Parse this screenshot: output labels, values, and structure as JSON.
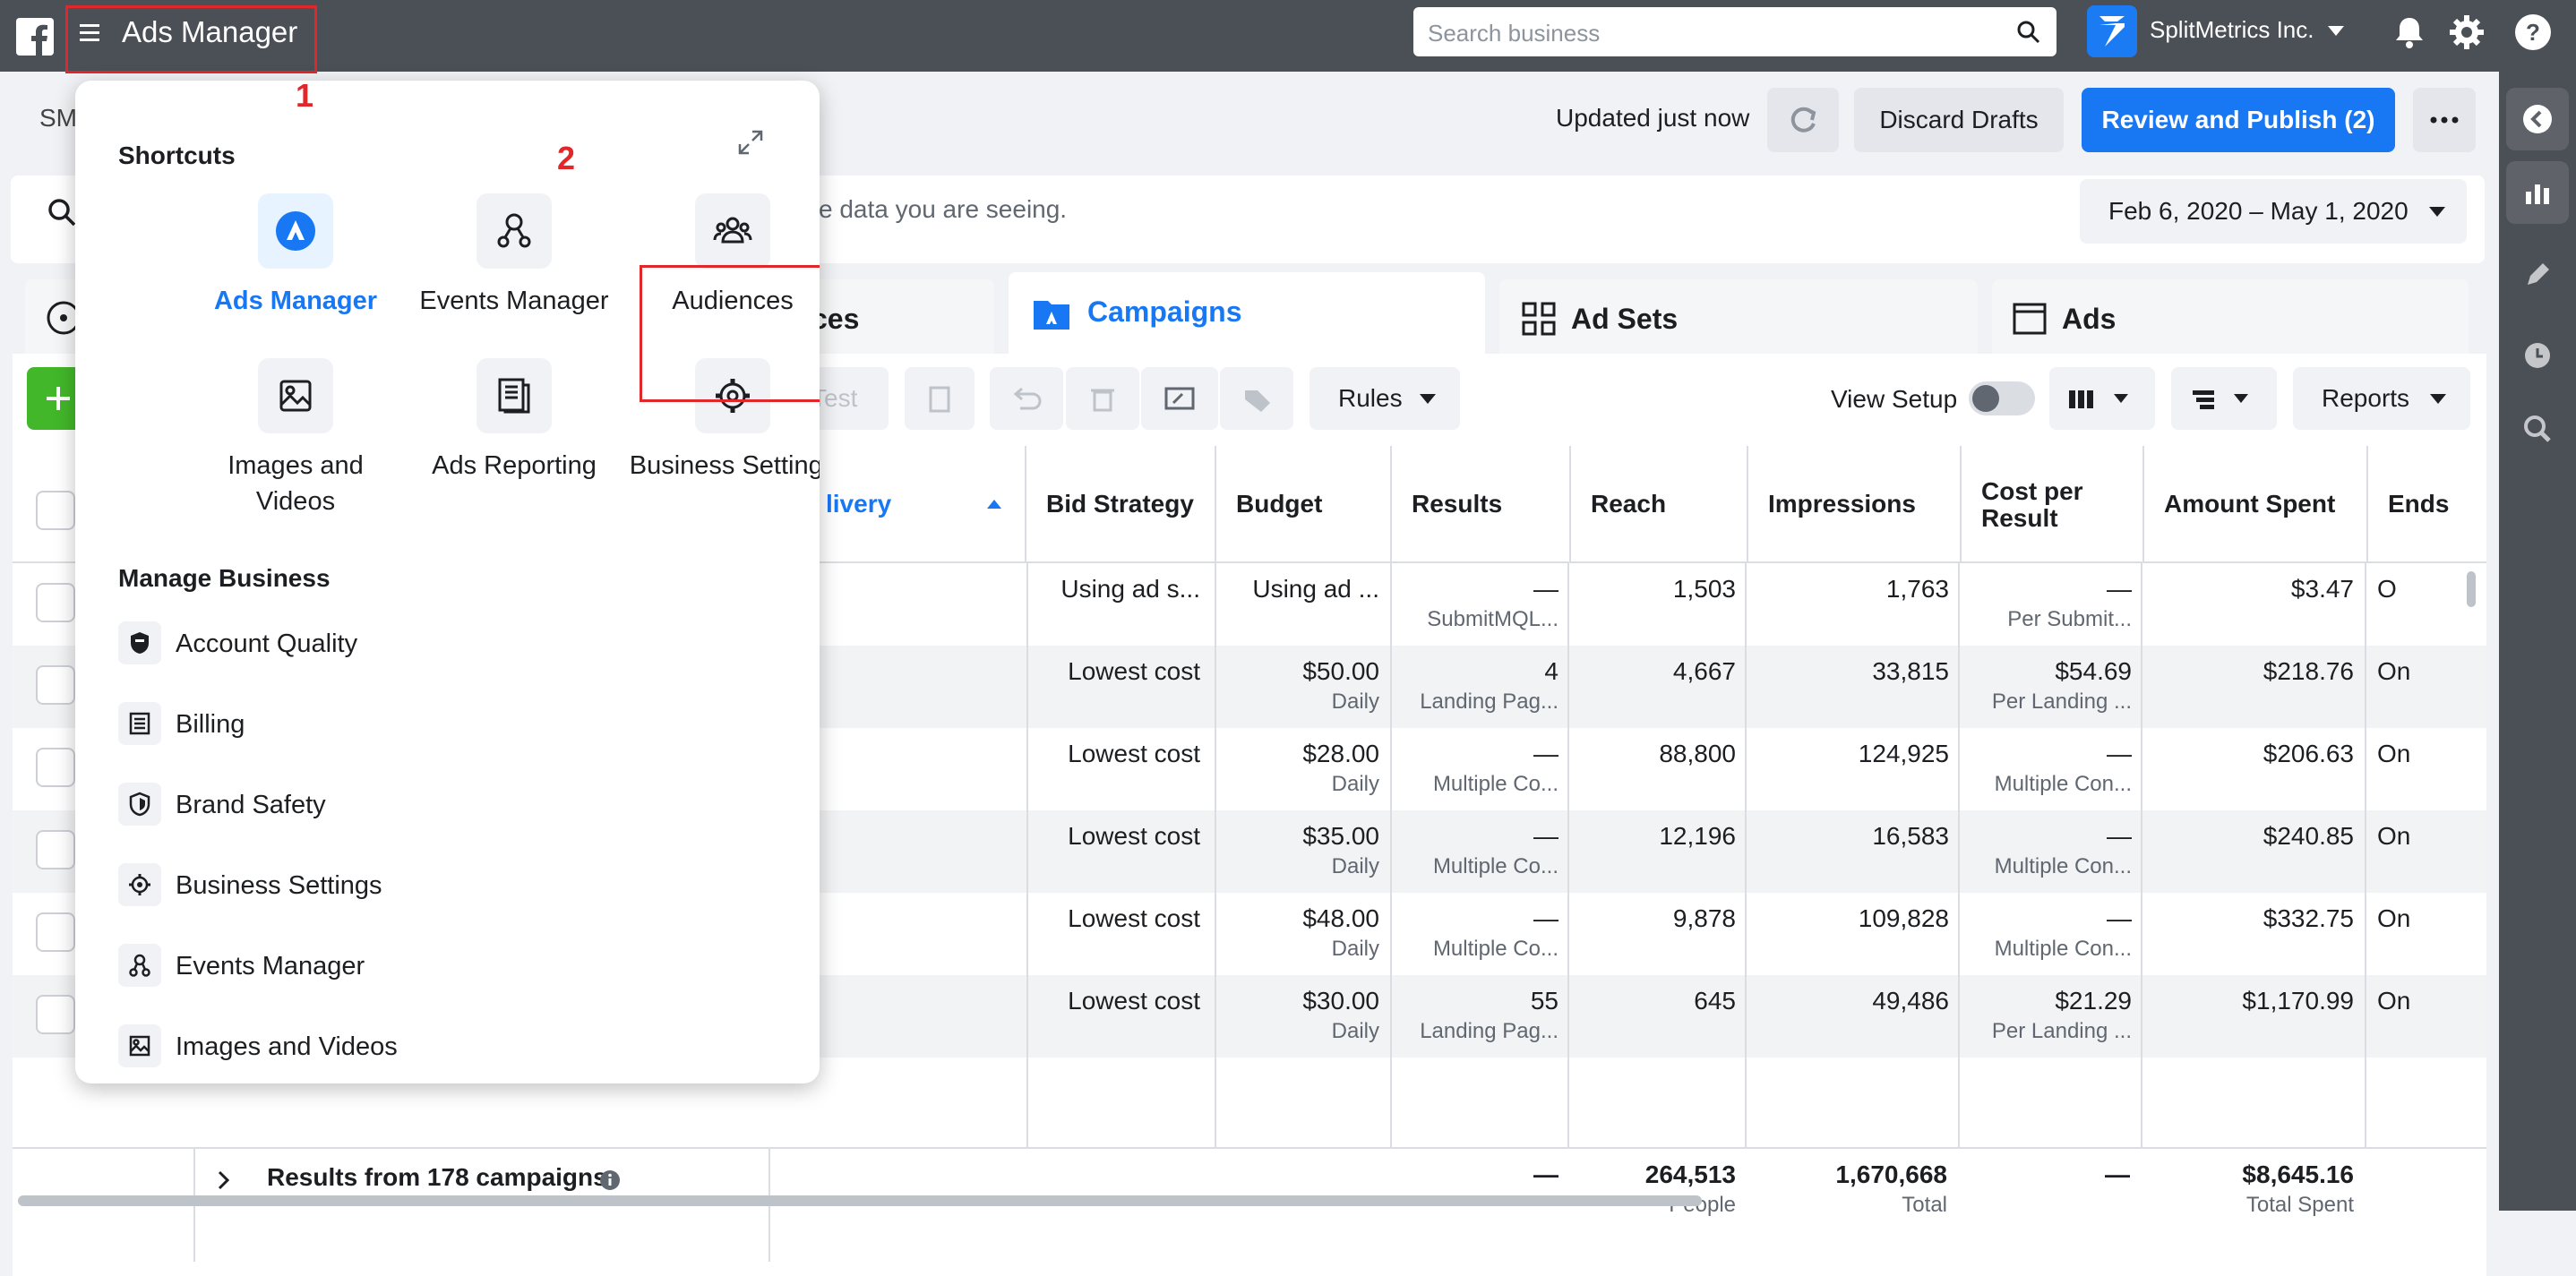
{
  "topbar": {
    "app_title": "Ads Manager",
    "search_placeholder": "Search business",
    "brand_name": "SplitMetrics Inc."
  },
  "annotations": {
    "label_1": "1",
    "label_2": "2"
  },
  "header": {
    "account_label": "SM",
    "updated": "Updated just now",
    "discard": "Discard Drafts",
    "publish": "Review and Publish (2)"
  },
  "filter": {
    "hint": "e data you are seeing.",
    "date_range": "Feb 6, 2020 – May 1, 2020"
  },
  "tabs": {
    "audiences_partial": "ces",
    "campaigns": "Campaigns",
    "ad_sets": "Ad Sets",
    "ads": "Ads"
  },
  "toolbar": {
    "test": "Test",
    "rules": "Rules",
    "view_setup": "View Setup",
    "reports": "Reports"
  },
  "columns": {
    "delivery": "livery",
    "bid_strategy": "Bid Strategy",
    "budget": "Budget",
    "results": "Results",
    "reach": "Reach",
    "impressions": "Impressions",
    "cost_per_result": "Cost per Result",
    "amount_spent": "Amount Spent",
    "ends": "Ends"
  },
  "rows": [
    {
      "bid": "Using ad s...",
      "budget": "Using ad ...",
      "budget_sub": "",
      "results": "—",
      "results_sub": "SubmitMQL...",
      "reach": "1,503",
      "impr": "1,763",
      "cpr": "—",
      "cpr_sub": "Per Submit...",
      "spent": "$3.47",
      "ends": "O"
    },
    {
      "bid": "Lowest cost",
      "budget": "$50.00",
      "budget_sub": "Daily",
      "results": "4",
      "results_sub": "Landing Pag...",
      "reach": "4,667",
      "impr": "33,815",
      "cpr": "$54.69",
      "cpr_sub": "Per Landing ...",
      "spent": "$218.76",
      "ends": "On"
    },
    {
      "bid": "Lowest cost",
      "budget": "$28.00",
      "budget_sub": "Daily",
      "results": "—",
      "results_sub": "Multiple Co...",
      "reach": "88,800",
      "impr": "124,925",
      "cpr": "—",
      "cpr_sub": "Multiple Con...",
      "spent": "$206.63",
      "ends": "On"
    },
    {
      "bid": "Lowest cost",
      "budget": "$35.00",
      "budget_sub": "Daily",
      "results": "—",
      "results_sub": "Multiple Co...",
      "reach": "12,196",
      "impr": "16,583",
      "cpr": "—",
      "cpr_sub": "Multiple Con...",
      "spent": "$240.85",
      "ends": "On"
    },
    {
      "bid": "Lowest cost",
      "budget": "$48.00",
      "budget_sub": "Daily",
      "results": "—",
      "results_sub": "Multiple Co...",
      "reach": "9,878",
      "impr": "109,828",
      "cpr": "—",
      "cpr_sub": "Multiple Con...",
      "spent": "$332.75",
      "ends": "On"
    },
    {
      "bid": "Lowest cost",
      "budget": "$30.00",
      "budget_sub": "Daily",
      "results": "55",
      "results_sub": "Landing Pag...",
      "reach": "645",
      "impr": "49,486",
      "cpr": "$21.29",
      "cpr_sub": "Per Landing ...",
      "spent": "$1,170.99",
      "ends": "On"
    }
  ],
  "footer": {
    "results_label": "Results from 178 campaigns",
    "results": "—",
    "reach": "264,513",
    "reach_sub": "People",
    "impr": "1,670,668",
    "impr_sub": "Total",
    "cpr": "—",
    "spent": "$8,645.16",
    "spent_sub": "Total Spent"
  },
  "dropdown": {
    "shortcuts_heading": "Shortcuts",
    "shortcuts": [
      "Ads Manager",
      "Events Manager",
      "Audiences",
      "Images and Videos",
      "Ads Reporting",
      "Business Settings"
    ],
    "manage_heading": "Manage Business",
    "manage_items": [
      "Account Quality",
      "Billing",
      "Brand Safety",
      "Business Settings",
      "Events Manager",
      "Images and Videos"
    ]
  },
  "colors": {
    "accent": "#1877f2",
    "topbar": "#4b4f56",
    "highlight": "#e0282b"
  }
}
